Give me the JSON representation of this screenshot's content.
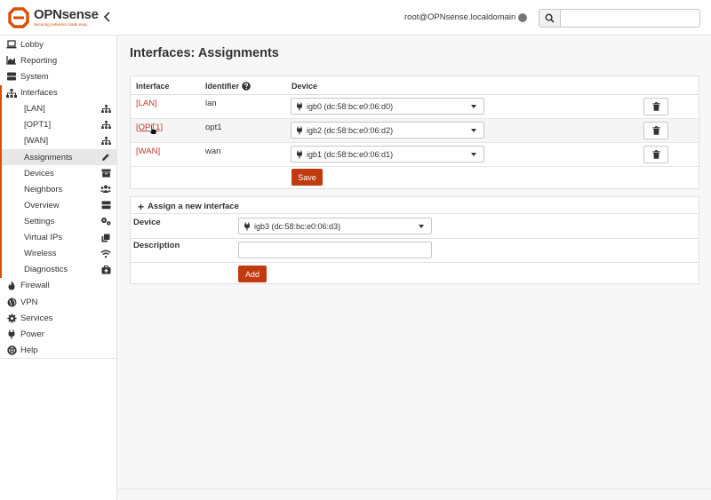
{
  "brand": {
    "name": "OPNsense",
    "tagline": "Securing networks made easy",
    "color": "#d94f00"
  },
  "header": {
    "user": "root@OPNsense.localdomain",
    "search_placeholder": ""
  },
  "sidebar": {
    "items": [
      {
        "label": "Lobby",
        "icon": "laptop-icon"
      },
      {
        "label": "Reporting",
        "icon": "area-chart-icon"
      },
      {
        "label": "System",
        "icon": "server-icon"
      },
      {
        "label": "Interfaces",
        "icon": "sitemap-icon"
      }
    ],
    "sub_items": [
      {
        "label": "[LAN]",
        "icon": "sitemap-icon"
      },
      {
        "label": "[OPT1]",
        "icon": "sitemap-icon"
      },
      {
        "label": "[WAN]",
        "icon": "sitemap-icon"
      },
      {
        "label": "Assignments",
        "icon": "pencil-icon"
      },
      {
        "label": "Devices",
        "icon": "archive-icon"
      },
      {
        "label": "Neighbors",
        "icon": "users-icon"
      },
      {
        "label": "Overview",
        "icon": "tasks-icon"
      },
      {
        "label": "Settings",
        "icon": "cogs-icon"
      },
      {
        "label": "Virtual IPs",
        "icon": "clone-icon"
      },
      {
        "label": "Wireless",
        "icon": "wifi-icon"
      },
      {
        "label": "Diagnostics",
        "icon": "medkit-icon"
      }
    ],
    "bottom_items": [
      {
        "label": "Firewall",
        "icon": "fire-icon"
      },
      {
        "label": "VPN",
        "icon": "globe-icon"
      },
      {
        "label": "Services",
        "icon": "cog-icon"
      },
      {
        "label": "Power",
        "icon": "plug-icon"
      },
      {
        "label": "Help",
        "icon": "support-icon"
      }
    ]
  },
  "page": {
    "title": "Interfaces: Assignments"
  },
  "table": {
    "headers": {
      "interface": "Interface",
      "identifier": "Identifier",
      "device": "Device"
    },
    "rows": [
      {
        "interface": "[LAN]",
        "identifier": "lan",
        "device": "igb0 (dc:58:bc:e0:06:d0)"
      },
      {
        "interface": "[OPT1]",
        "identifier": "opt1",
        "device": "igb2 (dc:58:bc:e0:06:d2)"
      },
      {
        "interface": "[WAN]",
        "identifier": "wan",
        "device": "igb1 (dc:58:bc:e0:06:d1)"
      }
    ],
    "save_label": "Save"
  },
  "assign": {
    "title": "Assign a new interface",
    "device_label": "Device",
    "device_value": "igb3 (dc:58:bc:e0:06:d3)",
    "description_label": "Description",
    "description_value": "",
    "add_label": "Add"
  }
}
